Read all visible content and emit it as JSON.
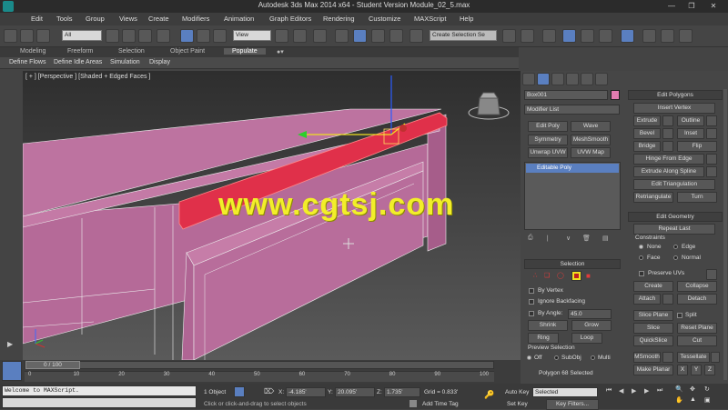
{
  "window": {
    "title": "Autodesk 3ds Max  2014 x64  - Student Version   Module_02_5.max"
  },
  "menu": [
    "Edit",
    "Tools",
    "Group",
    "Views",
    "Create",
    "Modifiers",
    "Animation",
    "Graph Editors",
    "Rendering",
    "Customize",
    "MAXScript",
    "Help"
  ],
  "toolbar": {
    "selection_filter": "All",
    "ref_coord": "View",
    "named_selection": "Create Selection Se"
  },
  "ribbon": {
    "tabs": [
      "Modeling",
      "Freeform",
      "Selection",
      "Object Paint",
      "Populate"
    ],
    "active_tab": "Populate",
    "sub_items": [
      "Define Flows",
      "Define Idle Areas",
      "Simulation",
      "Display"
    ]
  },
  "viewport": {
    "label": "[ + ] [Perspective ] [Shaded + Edged Faces ]"
  },
  "watermark": "www.cgtsj.com",
  "command_panel": {
    "object_name": "Box001",
    "modifier_list": "Modifier List",
    "modifier_buttons": [
      "Edit Poly",
      "Wave",
      "Symmetry",
      "MeshSmooth",
      "Unwrap UVW",
      "UVW Map"
    ],
    "stack_item": "Editable Poly",
    "selection": {
      "header": "Selection",
      "by_vertex": "By Vertex",
      "ignore_backfacing": "Ignore Backfacing",
      "by_angle": "By Angle:",
      "by_angle_value": "45.0",
      "shrink": "Shrink",
      "grow": "Grow",
      "ring": "Ring",
      "loop": "Loop",
      "preview_header": "Preview Selection",
      "preview_options": [
        "Off",
        "SubObj",
        "Multi"
      ],
      "status": "Polygon 68 Selected"
    },
    "edit_polygons": {
      "header": "Edit Polygons",
      "insert_vertex": "Insert Vertex",
      "extrude": "Extrude",
      "outline": "Outline",
      "bevel": "Bevel",
      "inset": "Inset",
      "bridge": "Bridge",
      "flip": "Flip",
      "hinge": "Hinge From Edge",
      "extrude_spline": "Extrude Along Spline",
      "edit_tri": "Edit Triangulation",
      "retriangulate": "Retriangulate",
      "turn": "Turn"
    },
    "edit_geometry": {
      "header": "Edit Geometry",
      "repeat_last": "Repeat Last",
      "constraints": "Constraints",
      "constraint_options": [
        "None",
        "Edge",
        "Face",
        "Normal"
      ],
      "preserve_uvs": "Preserve UVs",
      "create": "Create",
      "collapse": "Collapse",
      "attach": "Attach",
      "detach": "Detach",
      "slice_plane": "Slice Plane",
      "split": "Split",
      "slice": "Slice",
      "reset_plane": "Reset Plane",
      "quickslice": "QuickSlice",
      "cut": "Cut",
      "msmooth": "MSmooth",
      "tessellate": "Tessellate",
      "make_planar": "Make Planar",
      "x": "X",
      "y": "Y",
      "z": "Z"
    }
  },
  "timeline": {
    "frame": "0 / 100",
    "ticks": [
      "0",
      "10",
      "20",
      "30",
      "40",
      "50",
      "60",
      "70",
      "80",
      "90",
      "100"
    ]
  },
  "status_bar": {
    "script_text": "Welcome to MAXScript.",
    "objects": "1 Object",
    "x_label": "X:",
    "x": "-4.185'",
    "y_label": "Y:",
    "y": "20.095'",
    "z_label": "Z:",
    "z": "1.735'",
    "grid": "Grid = 0.833'",
    "prompt": "Click or click-and-drag to select objects",
    "add_time_tag": "Add Time Tag",
    "auto_key": "Auto Key",
    "auto_key_value": "Selected",
    "set_key": "Set Key",
    "key_filters": "Key Filters..."
  },
  "colors": {
    "object_pink": "#c77aa6",
    "selected_red": "#e0304a",
    "watermark": "#f2ee2a",
    "swatch": "#e07cb0"
  }
}
